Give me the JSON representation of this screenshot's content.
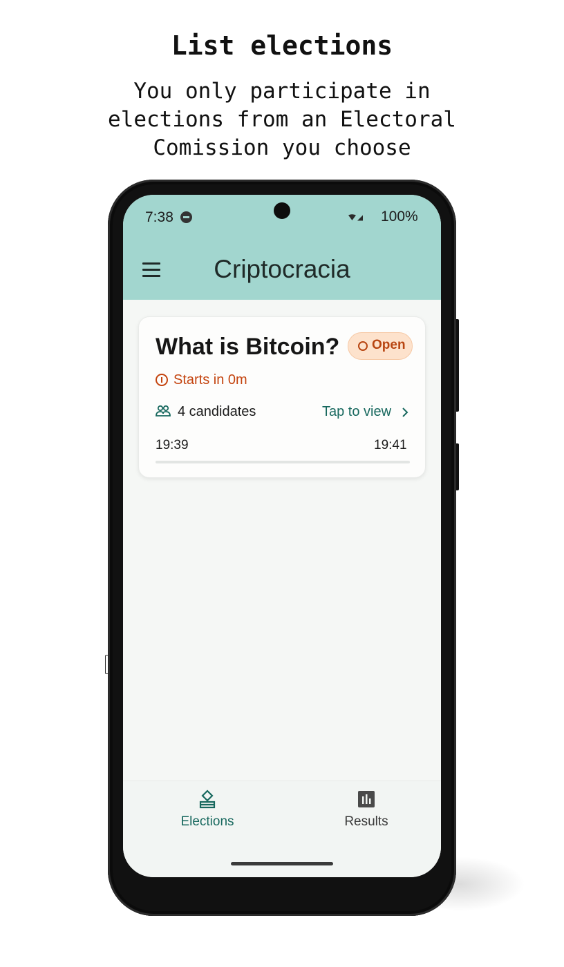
{
  "promo": {
    "title": "List elections",
    "subtitle": "You only participate in elections from an Electoral Comission you choose"
  },
  "status_bar": {
    "time": "7:38",
    "battery": "100%",
    "icons": [
      "do-not-disturb-icon",
      "wifi-icon",
      "signal-icon"
    ]
  },
  "app_bar": {
    "title": "Criptocracia",
    "menu_icon": "menu-icon"
  },
  "election_card": {
    "title": "What is Bitcoin?",
    "badge": "Open",
    "starts_text": "Starts in 0m",
    "candidates_text": "4 candidates",
    "link_text": "Tap to view",
    "start_time": "19:39",
    "end_time": "19:41",
    "progress": 0.0
  },
  "bottom_nav": {
    "items": [
      {
        "label": "Elections",
        "icon": "ballot-icon",
        "active": true
      },
      {
        "label": "Results",
        "icon": "bar-chart-icon",
        "active": false
      }
    ]
  },
  "colors": {
    "app_bar_bg": "#a2d6cf",
    "accent": "#17685e",
    "badge_text": "#b84511",
    "badge_bg": "#fde2cc",
    "warning": "#c4440f",
    "screen_bg": "#f5f7f5"
  }
}
